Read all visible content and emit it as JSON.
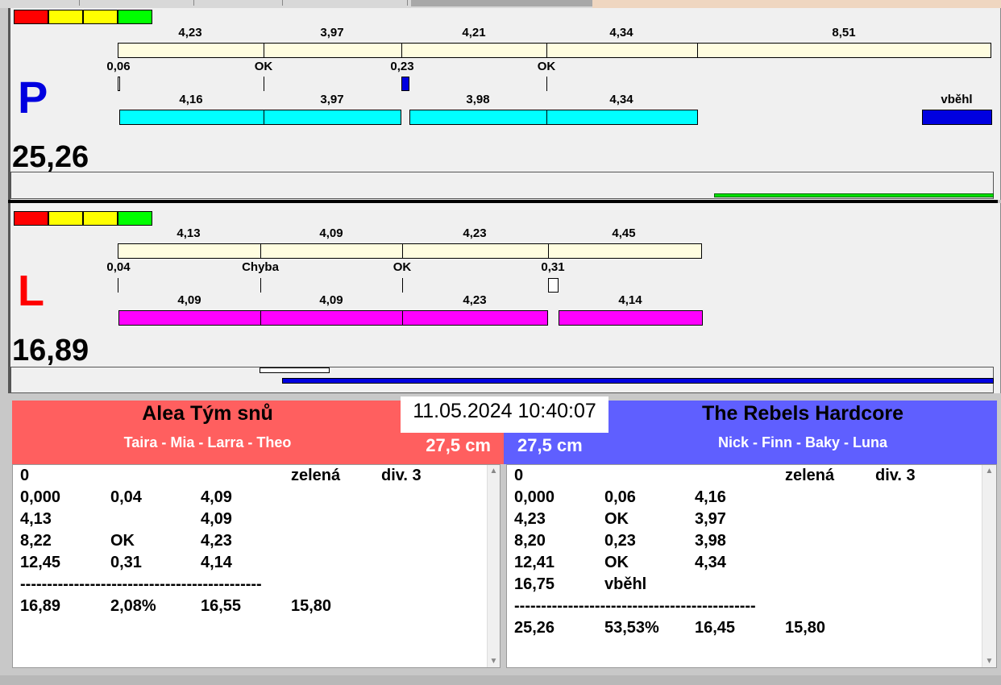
{
  "colors": {
    "red": "#ff0000",
    "yellow": "#ffff00",
    "green": "#00ff00",
    "cream": "#fffde0",
    "cyan": "#00ffff",
    "magenta": "#ff00ff",
    "blue": "#0000e0",
    "team_left": "#ff5f5f",
    "team_right": "#5f5fff"
  },
  "p": {
    "letter": "P",
    "total": "25,26",
    "top_labels": [
      "4,23",
      "3,97",
      "4,21",
      "4,34",
      "8,51"
    ],
    "mid_labels": [
      "0,06",
      "OK",
      "0,23",
      "OK"
    ],
    "bottom_labels": [
      "4,16",
      "3,97",
      "3,98",
      "4,34"
    ],
    "status": "vběhl"
  },
  "l": {
    "letter": "L",
    "total": "16,89",
    "top_labels": [
      "4,13",
      "4,09",
      "4,23",
      "4,45"
    ],
    "mid_labels": [
      "0,04",
      "Chyba",
      "OK",
      "0,31"
    ],
    "bottom_labels": [
      "4,09",
      "4,09",
      "4,23",
      "4,14"
    ]
  },
  "datetime": "11.05.2024 10:40:07",
  "left_team": {
    "name": "Alea Tým snů",
    "members": "Taira - Mia - Larra - Theo",
    "height": "27,5 cm",
    "rows": [
      [
        "0",
        "",
        "",
        "zelená",
        "div. 3"
      ],
      [
        "0,000",
        "0,04",
        "4,09",
        "",
        ""
      ],
      [
        "4,13",
        "",
        "4,09",
        "",
        ""
      ],
      [
        "8,22",
        "OK",
        "4,23",
        "",
        ""
      ],
      [
        "12,45",
        "0,31",
        "4,14",
        "",
        ""
      ],
      [
        "---------------------------------------------",
        "",
        "",
        "",
        ""
      ],
      [
        "16,89",
        "2,08%",
        "16,55",
        "15,80",
        ""
      ]
    ]
  },
  "right_team": {
    "name": "The Rebels Hardcore",
    "members": "Nick - Finn - Baky - Luna",
    "height": "27,5 cm",
    "rows": [
      [
        "0",
        "",
        "",
        "zelená",
        "div. 3"
      ],
      [
        "0,000",
        "0,06",
        "4,16",
        "",
        ""
      ],
      [
        "4,23",
        "OK",
        "3,97",
        "",
        ""
      ],
      [
        "8,20",
        "0,23",
        "3,98",
        "",
        ""
      ],
      [
        "12,41",
        "OK",
        "4,34",
        "",
        ""
      ],
      [
        "16,75",
        "vběhl",
        "",
        "",
        ""
      ],
      [
        "---------------------------------------------",
        "",
        "",
        "",
        ""
      ],
      [
        "25,26",
        "53,53%",
        "16,45",
        "15,80",
        ""
      ]
    ]
  }
}
